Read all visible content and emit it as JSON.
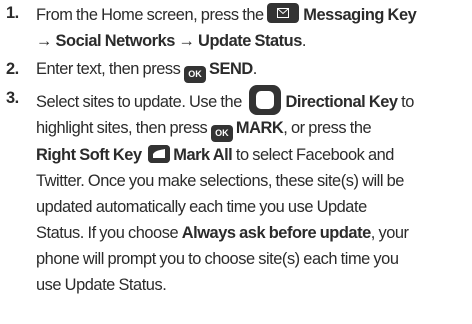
{
  "steps": [
    {
      "number": "1.",
      "line1_pre": "From the Home screen, press the",
      "line1_key": "Messaging Key",
      "line2": "→ Social Networks → Update Status",
      "line2_end": "."
    },
    {
      "number": "2.",
      "pre": "Enter text, then press",
      "ok_label": "OK",
      "key": "SEND",
      "post": "."
    },
    {
      "number": "3.",
      "l1_pre": "Select sites to update. Use the",
      "l1_key": "Directional Key",
      "l1_post": " to",
      "l2_pre": "highlight sites, then press",
      "ok_label": "OK",
      "l2_key": "MARK",
      "l2_post": ", or press the",
      "l3_key": "Right Soft Key",
      "l3_key2": "Mark All",
      "l3_post": " to select Facebook and",
      "l4": "Twitter. Once you make selections, these site(s) will be",
      "l5": "updated automatically each time you use Update",
      "l6_pre": "Status. If you choose ",
      "l6_bold": "Always ask before update",
      "l6_post": ", your",
      "l7": "phone will prompt you to choose site(s) each time you",
      "l8": "use Update Status."
    }
  ],
  "icons": {
    "messaging": "envelope-icon",
    "ok": "ok-key-icon",
    "directional": "directional-key-icon",
    "right_soft": "right-soft-key-icon"
  }
}
